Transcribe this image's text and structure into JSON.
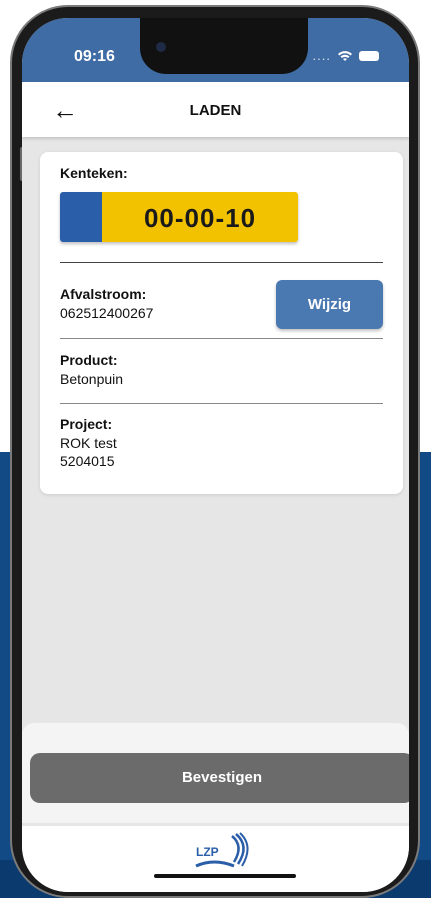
{
  "status_bar": {
    "time": "09:16",
    "signal_dots": "....",
    "wifi_icon": "wifi-icon",
    "battery_icon": "battery-icon"
  },
  "header": {
    "back_icon": "arrow-left-icon",
    "title": "LADEN"
  },
  "card": {
    "kenteken_label": "Kenteken:",
    "license_plate": "00-00-10",
    "afvalstroom_label": "Afvalstroom:",
    "afvalstroom_value": "062512400267",
    "wijzig_button": "Wijzig",
    "product_label": "Product:",
    "product_value": "Betonpuin",
    "project_label": "Project:",
    "project_name": "ROK test",
    "project_number": "5204015"
  },
  "footer": {
    "confirm_button": "Bevestigen",
    "logo_text": "LZP"
  },
  "colors": {
    "header_blue": "#3f6ca4",
    "plate_yellow": "#f2c200",
    "plate_blue": "#2a5ea8",
    "button_blue": "#4a78b0",
    "confirm_gray": "#6b6b6b",
    "background_blue": "#124a86"
  }
}
